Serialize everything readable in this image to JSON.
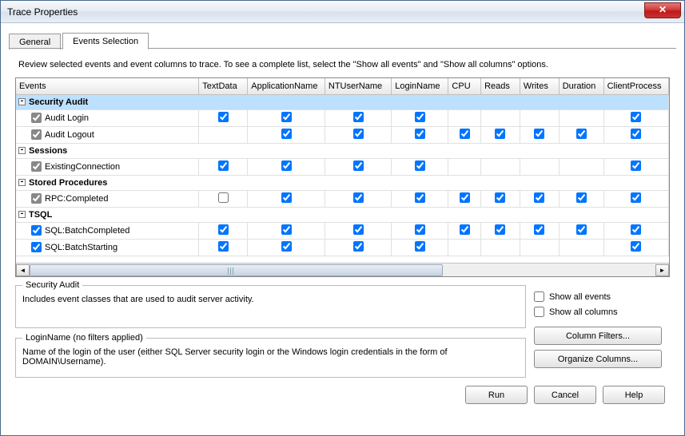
{
  "window": {
    "title": "Trace Properties"
  },
  "tabs": {
    "general": "General",
    "events_selection": "Events Selection"
  },
  "review_text": "Review selected events and event columns to trace. To see a complete list, select the \"Show all events\" and \"Show all columns\" options.",
  "columns": {
    "events": "Events",
    "textdata": "TextData",
    "appname": "ApplicationName",
    "ntusername": "NTUserName",
    "loginname": "LoginName",
    "cpu": "CPU",
    "reads": "Reads",
    "writes": "Writes",
    "duration": "Duration",
    "clientprocess": "ClientProcess"
  },
  "tree": {
    "security_audit": {
      "label": "Security Audit",
      "toggle": "-",
      "events": {
        "audit_login": {
          "label": "Audit Login",
          "enabled_gray": true,
          "cols": {
            "textdata": true,
            "appname": true,
            "ntusername": true,
            "loginname": true,
            "clientprocess": true
          }
        },
        "audit_logout": {
          "label": "Audit Logout",
          "enabled_gray": true,
          "cols": {
            "appname": true,
            "ntusername": true,
            "loginname": true,
            "cpu": true,
            "reads": true,
            "writes": true,
            "duration": true,
            "clientprocess": true
          }
        }
      }
    },
    "sessions": {
      "label": "Sessions",
      "toggle": "-",
      "events": {
        "existing_connection": {
          "label": "ExistingConnection",
          "enabled_gray": true,
          "cols": {
            "textdata": true,
            "appname": true,
            "ntusername": true,
            "loginname": true,
            "clientprocess": true
          }
        }
      }
    },
    "stored_procedures": {
      "label": "Stored Procedures",
      "toggle": "-",
      "events": {
        "rpc_completed": {
          "label": "RPC:Completed",
          "enabled_gray": true,
          "cols": {
            "textdata": false,
            "appname": true,
            "ntusername": true,
            "loginname": true,
            "cpu": true,
            "reads": true,
            "writes": true,
            "duration": true,
            "clientprocess": true
          }
        }
      }
    },
    "tsql": {
      "label": "TSQL",
      "toggle": "-",
      "events": {
        "batch_completed": {
          "label": "SQL:BatchCompleted",
          "enabled_gray": false,
          "cols": {
            "textdata": true,
            "appname": true,
            "ntusername": true,
            "loginname": true,
            "cpu": true,
            "reads": true,
            "writes": true,
            "duration": true,
            "clientprocess": true
          }
        },
        "batch_starting": {
          "label": "SQL:BatchStarting",
          "enabled_gray": false,
          "cols": {
            "textdata": true,
            "appname": true,
            "ntusername": true,
            "loginname": true,
            "clientprocess": true
          }
        }
      }
    }
  },
  "desc_group": {
    "legend": "Security Audit",
    "text": "Includes event classes that are used to audit server activity."
  },
  "filter_group": {
    "legend": "LoginName (no filters applied)",
    "text": "Name of the login of the user (either SQL Server security login or the Windows login credentials in the form of DOMAIN\\Username)."
  },
  "show_all_events": {
    "label": "Show all events",
    "checked": false
  },
  "show_all_columns": {
    "label": "Show all columns",
    "checked": false
  },
  "buttons": {
    "column_filters": "Column Filters...",
    "organize_columns": "Organize Columns...",
    "run": "Run",
    "cancel": "Cancel",
    "help": "Help"
  }
}
